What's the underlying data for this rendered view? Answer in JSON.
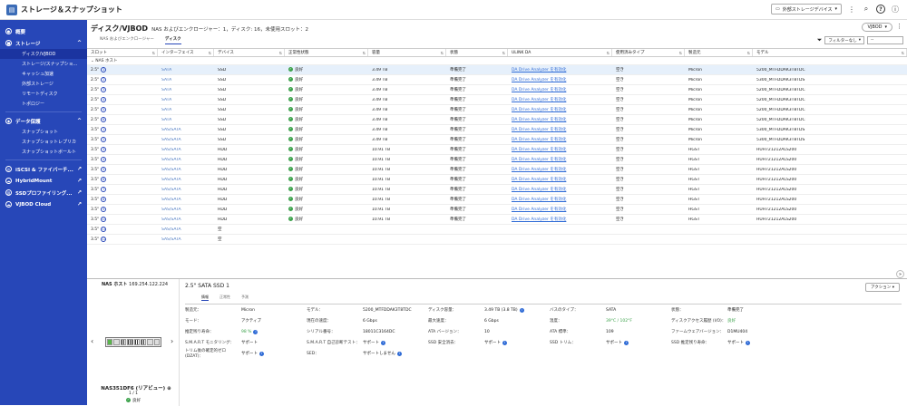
{
  "app": {
    "title": "ストレージ＆スナップショット",
    "external_device": "外部ストレージデバイス"
  },
  "sidebar": {
    "overview": "概要",
    "storage": "ストレージ",
    "storage_items": [
      "ディスク/VJBOD",
      "ストレージ/スナップショ...",
      "キャッシュ加速",
      "外部ストレージ",
      "リモートディスク",
      "トポロジー"
    ],
    "data_protection": "データ保護",
    "dp_items": [
      "スナップショット",
      "スナップショットレプリカ",
      "スナップショットボールト"
    ],
    "iscsi": "iSCSI & ファイバーチ...",
    "hybridmount": "HybridMount",
    "ssd_profiling": "SSDプロファイリング...",
    "vjbod_cloud": "VJBOD Cloud"
  },
  "page": {
    "title": "ディスク/VJBOD",
    "subtitle": "NAS およびエンクロージャー：1，ディスク: 16，未使用スロット：2",
    "vjbod_btn": "VJBOD",
    "tabs": [
      "NAS およびエンクロージャー",
      "ディスク"
    ],
    "filter_label": "フィルターなし",
    "filter2": "--"
  },
  "table": {
    "headers": [
      "スロット",
      "インターフェイス",
      "デバイス",
      "正常性状態",
      "容量",
      "状態",
      "ULINK DA",
      "使用済みタイプ",
      "製造元",
      "モデル"
    ],
    "group": "NAS ホスト",
    "rows": [
      {
        "slot": "2.5\"",
        "num": "1",
        "iface": "SATA",
        "dev": "SSD",
        "health": "良好",
        "cap": "3.49 TB",
        "state": "準備完了",
        "da": "DA Drive Analyzer を有効化",
        "type": "空き",
        "mfr": "Micron",
        "model": "5200_MTFDDAK3T8TDC"
      },
      {
        "slot": "2.5\"",
        "num": "2",
        "iface": "SATA",
        "dev": "SSD",
        "health": "良好",
        "cap": "3.49 TB",
        "state": "準備完了",
        "da": "DA Drive Analyzer を有効化",
        "type": "空き",
        "mfr": "Micron",
        "model": "5300_MTFDDAK3T8TDS"
      },
      {
        "slot": "2.5\"",
        "num": "3",
        "iface": "SATA",
        "dev": "SSD",
        "health": "良好",
        "cap": "3.49 TB",
        "state": "準備完了",
        "da": "DA Drive Analyzer を有効化",
        "type": "空き",
        "mfr": "Micron",
        "model": "5200_MTFDDAK3T8TDC"
      },
      {
        "slot": "2.5\"",
        "num": "4",
        "iface": "SATA",
        "dev": "SSD",
        "health": "良好",
        "cap": "3.49 TB",
        "state": "準備完了",
        "da": "DA Drive Analyzer を有効化",
        "type": "空き",
        "mfr": "Micron",
        "model": "5200_MTFDDAK3T8TDC"
      },
      {
        "slot": "2.5\"",
        "num": "5",
        "iface": "SATA",
        "dev": "SSD",
        "health": "良好",
        "cap": "3.49 TB",
        "state": "準備完了",
        "da": "DA Drive Analyzer を有効化",
        "type": "空き",
        "mfr": "Micron",
        "model": "5200_MTFDDAK3T8TDC"
      },
      {
        "slot": "2.5\"",
        "num": "6",
        "iface": "SATA",
        "dev": "SSD",
        "health": "良好",
        "cap": "3.49 TB",
        "state": "準備完了",
        "da": "DA Drive Analyzer を有効化",
        "type": "空き",
        "mfr": "Micron",
        "model": "5200_MTFDDAK3T8TDC"
      },
      {
        "slot": "3.5\"",
        "num": "1",
        "iface": "SAS/SATA",
        "dev": "SSD",
        "health": "良好",
        "cap": "3.49 TB",
        "state": "準備完了",
        "da": "DA Drive Analyzer を有効化",
        "type": "空き",
        "mfr": "Micron",
        "model": "5300_MTFDDAK3T8TDS"
      },
      {
        "slot": "3.5\"",
        "num": "2",
        "iface": "SAS/SATA",
        "dev": "SSD",
        "health": "良好",
        "cap": "3.49 TB",
        "state": "準備完了",
        "da": "DA Drive Analyzer を有効化",
        "type": "空き",
        "mfr": "Micron",
        "model": "5300_MTFDDAK3T8TDS"
      },
      {
        "slot": "3.5\"",
        "num": "3",
        "iface": "SAS/SATA",
        "dev": "HDD",
        "health": "良好",
        "cap": "10.91 TB",
        "state": "準備完了",
        "da": "DA Drive Analyzer を有効化",
        "type": "空き",
        "mfr": "HGST",
        "model": "HUH721212ALS200"
      },
      {
        "slot": "3.5\"",
        "num": "4",
        "iface": "SAS/SATA",
        "dev": "HDD",
        "health": "良好",
        "cap": "10.91 TB",
        "state": "準備完了",
        "da": "DA Drive Analyzer を有効化",
        "type": "空き",
        "mfr": "HGST",
        "model": "HUH721212ALS200"
      },
      {
        "slot": "3.5\"",
        "num": "5",
        "iface": "SAS/SATA",
        "dev": "HDD",
        "health": "良好",
        "cap": "10.91 TB",
        "state": "準備完了",
        "da": "DA Drive Analyzer を有効化",
        "type": "空き",
        "mfr": "HGST",
        "model": "HUH721212ALS200"
      },
      {
        "slot": "3.5\"",
        "num": "6",
        "iface": "SAS/SATA",
        "dev": "HDD",
        "health": "良好",
        "cap": "10.91 TB",
        "state": "準備完了",
        "da": "DA Drive Analyzer を有効化",
        "type": "空き",
        "mfr": "HGST",
        "model": "HUH721212ALS200"
      },
      {
        "slot": "3.5\"",
        "num": "7",
        "iface": "SAS/SATA",
        "dev": "HDD",
        "health": "良好",
        "cap": "10.91 TB",
        "state": "準備完了",
        "da": "DA Drive Analyzer を有効化",
        "type": "空き",
        "mfr": "HGST",
        "model": "HUH721212ALS200"
      },
      {
        "slot": "3.5\"",
        "num": "8",
        "iface": "SAS/SATA",
        "dev": "HDD",
        "health": "良好",
        "cap": "10.91 TB",
        "state": "準備完了",
        "da": "DA Drive Analyzer を有効化",
        "type": "空き",
        "mfr": "HGST",
        "model": "HUH721212ALS200"
      },
      {
        "slot": "3.5\"",
        "num": "9",
        "iface": "SAS/SATA",
        "dev": "HDD",
        "health": "良好",
        "cap": "10.91 TB",
        "state": "準備完了",
        "da": "DA Drive Analyzer を有効化",
        "type": "空き",
        "mfr": "HGST",
        "model": "HUH721212ALS200"
      },
      {
        "slot": "3.5\"",
        "num": "10",
        "iface": "SAS/SATA",
        "dev": "HDD",
        "health": "良好",
        "cap": "10.91 TB",
        "state": "準備完了",
        "da": "DA Drive Analyzer を有効化",
        "type": "空き",
        "mfr": "HGST",
        "model": "HUH721212ALS200"
      },
      {
        "slot": "3.5\"",
        "num": "11",
        "iface": "SAS/SATA",
        "dev": "空",
        "health": "",
        "cap": "",
        "state": "",
        "da": "",
        "type": "",
        "mfr": "",
        "model": ""
      },
      {
        "slot": "3.5\"",
        "num": "12",
        "iface": "SAS/SATA",
        "dev": "空",
        "health": "",
        "cap": "",
        "state": "",
        "da": "",
        "type": "",
        "mfr": "",
        "model": ""
      }
    ]
  },
  "detail": {
    "host": "NAS ホスト",
    "ip": "169.254.122.224",
    "nas_name": "NAS351DF6 (リアビュー)",
    "pager": "1 / 1",
    "nas_status": "良好",
    "title": "2.5\" SATA SSD 1",
    "action": "アクション",
    "tabs": [
      "情報",
      "正常性",
      "予測"
    ],
    "props": [
      [
        "製造元：",
        "Micron",
        "モデル：",
        "5200_MTFDDAK3T8TDC",
        "ディスク容量：",
        "3.49 TB (3.8 TB)",
        "バスのタイプ：",
        "SATA",
        "状態：",
        "準備完了"
      ],
      [
        "モード：",
        "アクティブ",
        "現在の速度：",
        "6 Gbps",
        "最大速度：",
        "6 Gbps",
        "温度：",
        "39°C / 102°F",
        "ディスクアクセス履歴 (I/O)：",
        "良好"
      ],
      [
        "推定残り寿命：",
        "98 %",
        "シリアル番号：",
        "18011C3164DC",
        "ATA バージョン：",
        "10",
        "ATA 標準：",
        "109",
        "ファームウェアバージョン：",
        "D1MU404"
      ],
      [
        "S.M.A.R.T モニタリング：",
        "サポート",
        "S.M.A.R.T 自己診断テスト：",
        "サポート",
        "SSD 安全消去：",
        "サポート",
        "SSD トリム：",
        "サポート",
        "SSD 推定残り寿命：",
        "サポート"
      ],
      [
        "トリム後の確定的ゼロ (DZAT)：",
        "サポート",
        "SED：",
        "サポートしません",
        "",
        "",
        "",
        "",
        "",
        ""
      ]
    ]
  }
}
